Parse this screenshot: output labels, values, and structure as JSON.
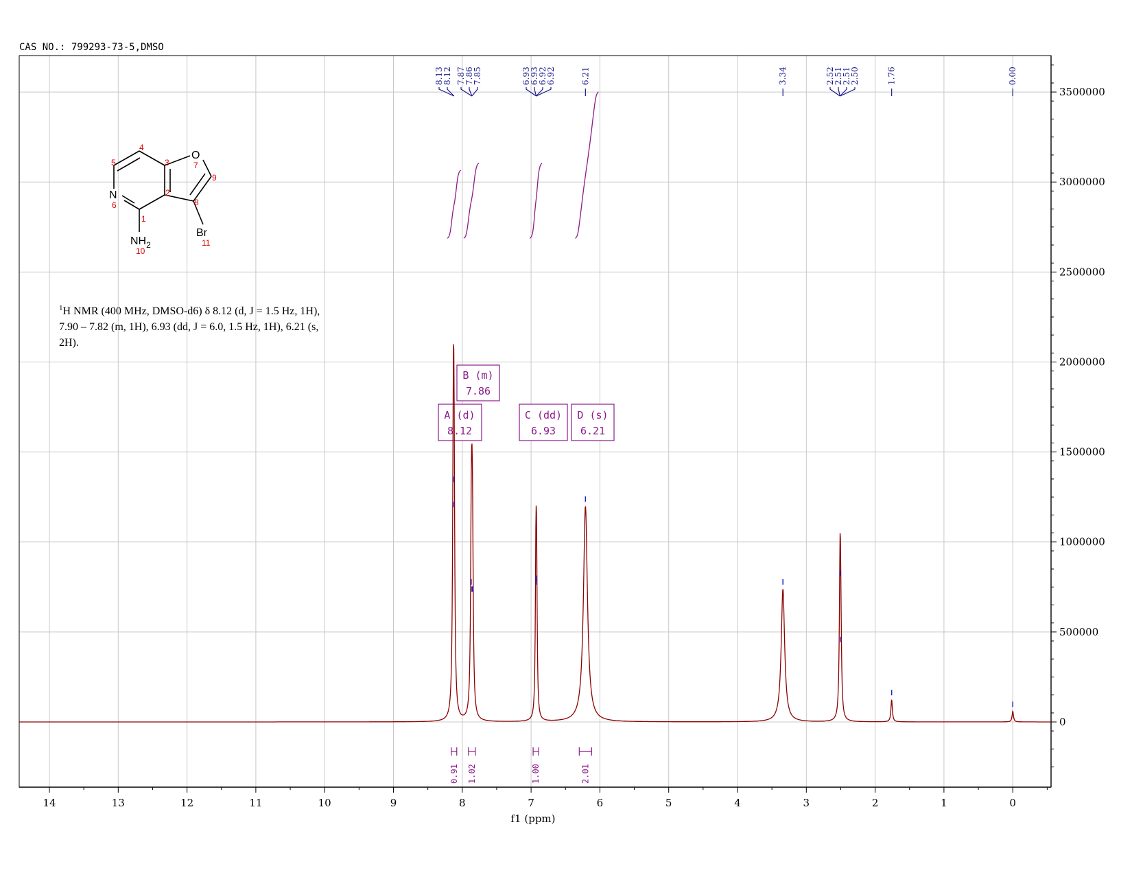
{
  "header": {
    "title": "CAS NO.: 799293-73-5,DMSO"
  },
  "chart_data": {
    "type": "line",
    "title": "",
    "xlabel": "f1 (ppm)",
    "ylabel": "",
    "x_reversed": true,
    "xlim": [
      14.45,
      -0.5
    ],
    "ylim": [
      -340000,
      3700000
    ],
    "x_ticks": [
      "14",
      "13",
      "12",
      "11",
      "10",
      "9",
      "8",
      "7",
      "6",
      "5",
      "4",
      "3",
      "2",
      "1",
      "0"
    ],
    "y_ticks": [
      "3500000",
      "3000000",
      "2500000",
      "2000000",
      "1500000",
      "1000000",
      "500000",
      "0"
    ],
    "grid": true,
    "series": [
      {
        "peaks": [
          {
            "ppm": 8.13,
            "height": 1310000,
            "width": 0.012
          },
          {
            "ppm": 8.12,
            "height": 1170000,
            "width": 0.012
          },
          {
            "ppm": 7.87,
            "height": 740000,
            "width": 0.012
          },
          {
            "ppm": 7.86,
            "height": 700000,
            "width": 0.012
          },
          {
            "ppm": 7.85,
            "height": 700000,
            "width": 0.012
          },
          {
            "ppm": 6.93,
            "height": 760000,
            "width": 0.01
          },
          {
            "ppm": 6.92,
            "height": 740000,
            "width": 0.01
          },
          {
            "ppm": 6.21,
            "height": 1200000,
            "width": 0.035
          },
          {
            "ppm": 3.34,
            "height": 740000,
            "width": 0.03
          },
          {
            "ppm": 2.51,
            "height": 790000,
            "width": 0.012
          },
          {
            "ppm": 2.5,
            "height": 420000,
            "width": 0.012
          },
          {
            "ppm": 1.76,
            "height": 125000,
            "width": 0.012
          },
          {
            "ppm": 0.0,
            "height": 60000,
            "width": 0.012
          }
        ]
      }
    ],
    "peak_picks": [
      "8.13",
      "8.12",
      "7.87",
      "7.86",
      "7.85",
      "6.93",
      "6.93",
      "6.92",
      "6.92",
      "6.21",
      "3.34",
      "2.52",
      "2.51",
      "2.51",
      "2.50",
      "1.76",
      "0.00"
    ],
    "multiplets": [
      {
        "label": "A (d)",
        "value": "8.12"
      },
      {
        "label": "B (m)",
        "value": "7.86"
      },
      {
        "label": "C (dd)",
        "value": "6.93"
      },
      {
        "label": "D (s)",
        "value": "6.21"
      }
    ],
    "integrals": [
      {
        "ppm": 8.12,
        "value": "0.91"
      },
      {
        "ppm": 7.86,
        "value": "1.02"
      },
      {
        "ppm": 6.93,
        "value": "1.00"
      },
      {
        "ppm": 6.21,
        "value": "2.01"
      }
    ]
  },
  "nmr_description": {
    "line1": "H NMR (400 MHz, DMSO-d6) δ 8.12 (d, J = 1.5 Hz, 1H),",
    "line2": "7.90 – 7.82 (m, 1H), 6.93 (dd, J = 6.0, 1.5 Hz, 1H), 6.21 (s,",
    "line3": "2H).",
    "sup": "1"
  },
  "structure": {
    "atoms": {
      "O": "O",
      "N": "N",
      "NH": "NH",
      "sub2": "2",
      "Br": "Br"
    },
    "numbers": [
      "1",
      "2",
      "3",
      "4",
      "5",
      "6",
      "7",
      "8",
      "9",
      "10",
      "11"
    ]
  },
  "colors": {
    "spectrum": "#8b0000",
    "peak_label": "#1a1a8c",
    "integral": "#8b1a8b",
    "grid": "#c8c8c8"
  }
}
